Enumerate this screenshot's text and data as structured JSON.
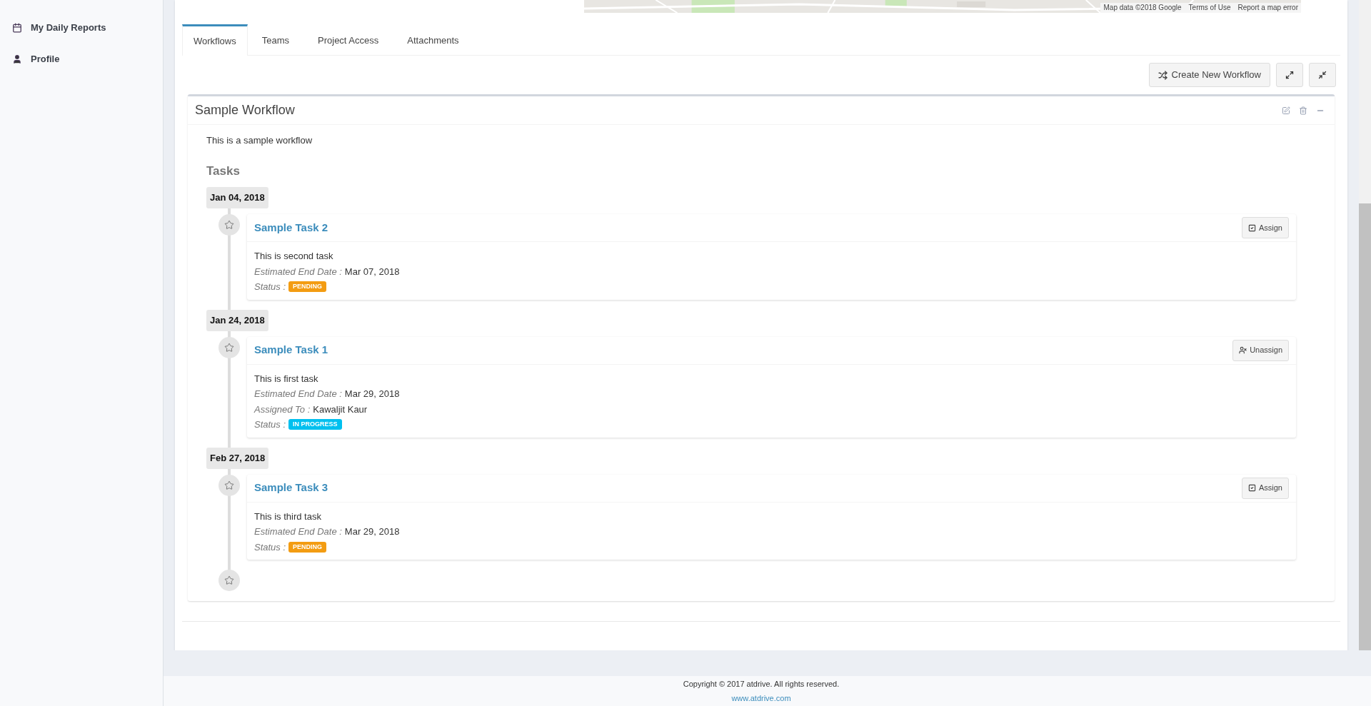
{
  "sidebar": {
    "items": [
      {
        "label": "My Daily Reports"
      },
      {
        "label": "Profile"
      }
    ]
  },
  "map": {
    "attribution": [
      "Map data ©2018 Google",
      "Terms of Use",
      "Report a map error"
    ]
  },
  "tabs": [
    {
      "label": "Workflows",
      "selected": true
    },
    {
      "label": "Teams",
      "selected": false
    },
    {
      "label": "Project Access",
      "selected": false
    },
    {
      "label": "Attachments",
      "selected": false
    }
  ],
  "toolbar": {
    "create_button": "Create New Workflow"
  },
  "workflow": {
    "title": "Sample Workflow",
    "description": "This is a sample workflow",
    "tasks_heading": "Tasks",
    "groups": [
      {
        "date": "Jan 04, 2018",
        "task": {
          "title": "Sample Task 2",
          "action": {
            "kind": "assign",
            "label": "Assign"
          },
          "description": "This is second task",
          "fields": [
            {
              "label": "Estimated End Date :",
              "value": "Mar 07, 2018"
            }
          ],
          "status_label": "Status :",
          "status": {
            "kind": "pending",
            "text": "PENDING"
          }
        }
      },
      {
        "date": "Jan 24, 2018",
        "task": {
          "title": "Sample Task 1",
          "action": {
            "kind": "unassign",
            "label": "Unassign"
          },
          "description": "This is first task",
          "fields": [
            {
              "label": "Estimated End Date :",
              "value": "Mar 29, 2018"
            },
            {
              "label": "Assigned To :",
              "value": "Kawaljit Kaur"
            }
          ],
          "status_label": "Status :",
          "status": {
            "kind": "in_progress",
            "text": "IN PROGRESS"
          }
        }
      },
      {
        "date": "Feb 27, 2018",
        "task": {
          "title": "Sample Task 3",
          "action": {
            "kind": "assign",
            "label": "Assign"
          },
          "description": "This is third task",
          "fields": [
            {
              "label": "Estimated End Date :",
              "value": "Mar 29, 2018"
            }
          ],
          "status_label": "Status :",
          "status": {
            "kind": "pending",
            "text": "PENDING"
          }
        }
      }
    ]
  },
  "footer": {
    "copyright": "Copyright © 2017 atdrive. All rights reserved.",
    "link": "www.atdrive.com"
  }
}
